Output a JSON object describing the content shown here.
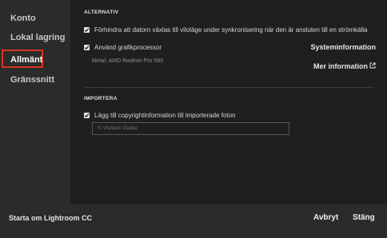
{
  "sidebar": {
    "items": [
      {
        "label": "Konto"
      },
      {
        "label": "Lokal lagring"
      },
      {
        "label": "Allmänt"
      },
      {
        "label": "Gränssnitt"
      }
    ]
  },
  "alternativ": {
    "title": "ALTERNATIV",
    "prevent_sleep_label": "Förhindra att datorn växlas till viloläge under synkronisering när den är ansluten till en strömkälla",
    "gpu_label": "Använd grafikprocessor",
    "gpu_info": "Metal: AMD Radeon Pro 560",
    "system_info_link": "Systeminformation",
    "more_info_link": "Mer information"
  },
  "importera": {
    "title": "IMPORTERA",
    "copyright_label": "Lägg till copyrightinformation till importerade foton",
    "copyright_value": "© Vishesh Gupta"
  },
  "footer": {
    "about_label": "Starta om Lightroom CC",
    "cancel_label": "Avbryt",
    "close_label": "Stäng"
  },
  "colors": {
    "highlight": "#d9341f",
    "content_bg": "#1f1f1f",
    "sidebar_bg": "#2b2b2b"
  }
}
